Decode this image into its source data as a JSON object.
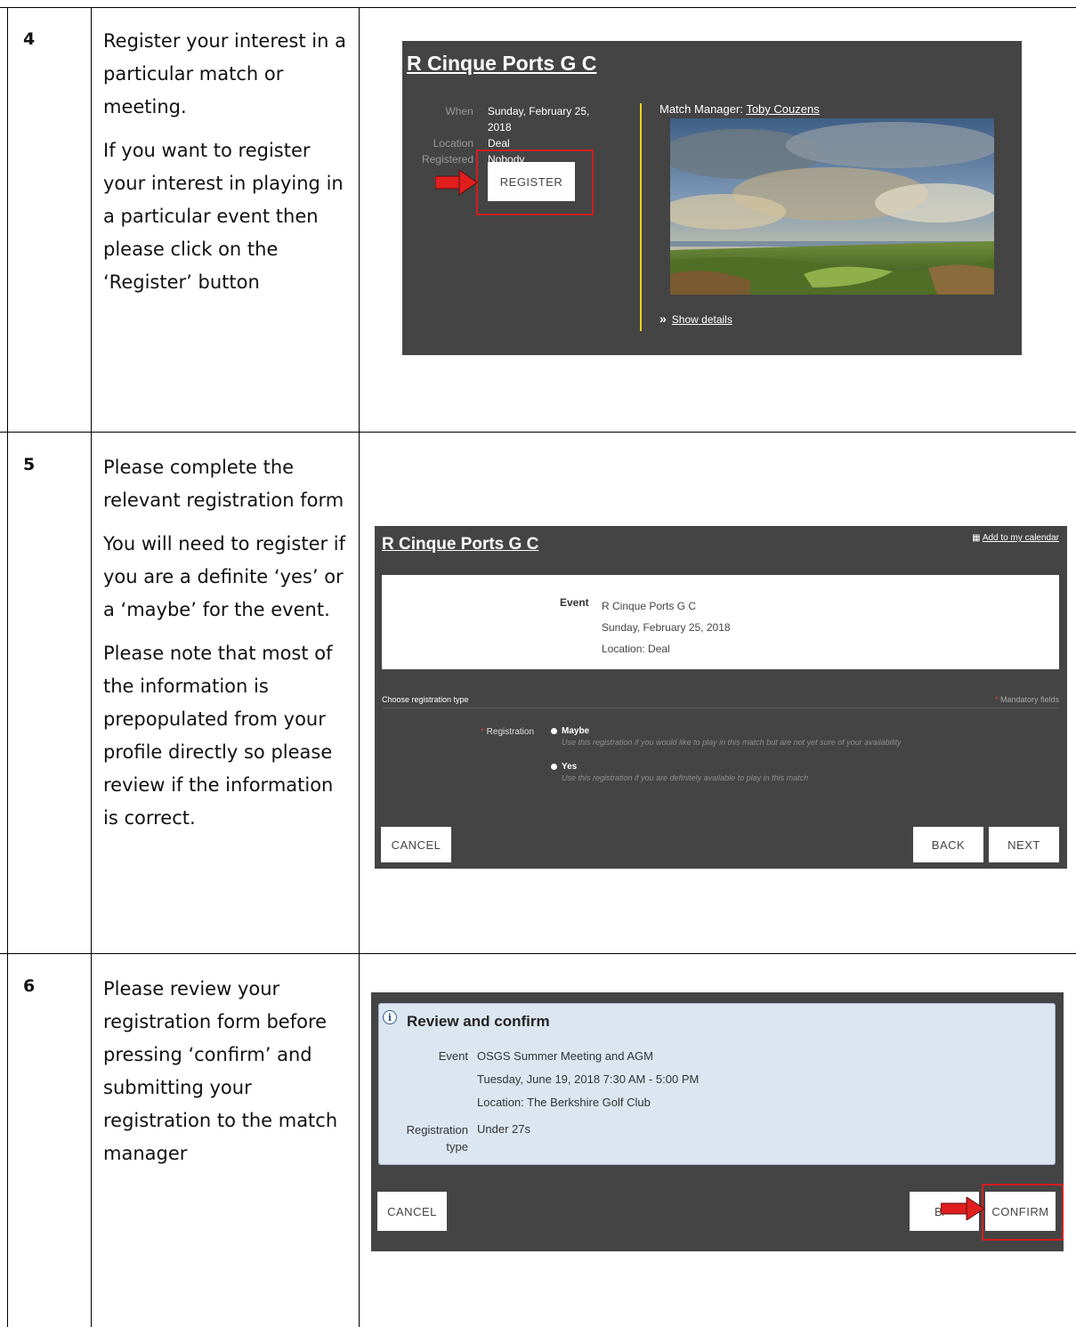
{
  "rows": [
    {
      "number": "4",
      "paragraphs": [
        "Register your interest in a particular match or meeting.",
        "If you want to register your interest in playing in a particular event then please click on the ‘Register’ button"
      ]
    },
    {
      "number": "5",
      "paragraphs": [
        "Please complete the relevant registration form",
        "You will need to register if you are a definite ‘yes’ or a ‘maybe’ for the event.",
        "Please note that most of the information is prepopulated from your profile directly so please review if the information is correct."
      ]
    },
    {
      "number": "6",
      "paragraphs": [
        "Please review your registration form before pressing ‘confirm’ and submitting your registration to the match manager"
      ]
    }
  ],
  "panel1": {
    "title": "R Cinque Ports G C",
    "when_label": "When",
    "when_value": "Sunday, February 25, 2018",
    "location_label": "Location",
    "location_value": "Deal",
    "registered_label": "Registered",
    "registered_value": "Nobody",
    "register_button": "REGISTER",
    "match_manager_label": "Match Manager:",
    "match_manager_name": "Toby Couzens",
    "show_details": "Show details"
  },
  "panel2": {
    "title": "R Cinque Ports G C",
    "add_calendar": "Add to my calendar",
    "event_label": "Event",
    "event_name": "R Cinque Ports G C",
    "event_date": "Sunday, February 25, 2018",
    "event_location": "Location: Deal",
    "section_label": "Choose registration type",
    "mandatory_text": "Mandatory fields",
    "registration_label": "Registration",
    "options": [
      {
        "name": "Maybe",
        "desc": "Use this registration if you would like to play in this match but are not yet sure of your availability"
      },
      {
        "name": "Yes",
        "desc": "Use this registration if you are definitely available to play in this match"
      }
    ],
    "cancel": "CANCEL",
    "back": "BACK",
    "next": "NEXT"
  },
  "panel3": {
    "title": "Review and confirm",
    "event_label": "Event",
    "event_name": "OSGS Summer Meeting and AGM",
    "event_date": "Tuesday, June 19, 2018 7:30 AM - 5:00 PM",
    "event_location": "Location: The Berkshire Golf Club",
    "reg_type_label_1": "Registration",
    "reg_type_label_2": "type",
    "reg_type_value": "Under 27s",
    "cancel": "CANCEL",
    "back_partial": "B/",
    "confirm": "CONFIRM"
  },
  "colors": {
    "panel_bg": "#444444",
    "highlight_red": "#d21f1f",
    "divider_yellow": "#f2d21b",
    "review_card_bg": "#dce6f0"
  },
  "icons": [
    "red-arrow-icon",
    "calendar-icon",
    "double-chevron-icon",
    "info-icon",
    "radio-dot-icon"
  ]
}
